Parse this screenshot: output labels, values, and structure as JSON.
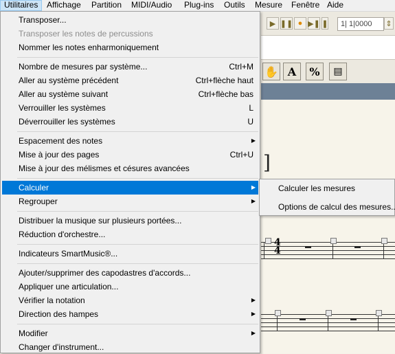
{
  "menubar": {
    "items": [
      "Utilitaires",
      "Affichage",
      "Partition",
      "MIDI/Audio",
      "Plug-ins",
      "Outils",
      "Mesure",
      "Fenêtre",
      "Aide"
    ]
  },
  "background": {
    "counter_value": "1| 1|0000",
    "tool_a": "A",
    "tool_percent": "%"
  },
  "menu": {
    "items": [
      {
        "label": "Transposer...",
        "shortcut": "",
        "submenu": false,
        "disabled": false
      },
      {
        "label": "Transposer les notes de percussions",
        "shortcut": "",
        "submenu": false,
        "disabled": true
      },
      {
        "label": "Nommer les notes enharmoniquement",
        "shortcut": "",
        "submenu": false,
        "disabled": false
      },
      {
        "label": "Nombre de mesures par système...",
        "shortcut": "Ctrl+M",
        "submenu": false,
        "disabled": false
      },
      {
        "label": "Aller au système précédent",
        "shortcut": "Ctrl+flèche haut",
        "submenu": false,
        "disabled": false
      },
      {
        "label": "Aller au système suivant",
        "shortcut": "Ctrl+flèche bas",
        "submenu": false,
        "disabled": false
      },
      {
        "label": "Verrouiller les systèmes",
        "shortcut": "L",
        "submenu": false,
        "disabled": false
      },
      {
        "label": "Déverrouiller les systèmes",
        "shortcut": "U",
        "submenu": false,
        "disabled": false
      },
      {
        "label": "Espacement des notes",
        "shortcut": "",
        "submenu": true,
        "disabled": false
      },
      {
        "label": "Mise à jour des pages",
        "shortcut": "Ctrl+U",
        "submenu": false,
        "disabled": false
      },
      {
        "label": "Mise à jour des mélismes et césures avancées",
        "shortcut": "",
        "submenu": false,
        "disabled": false
      },
      {
        "label": "Calculer",
        "shortcut": "",
        "submenu": true,
        "disabled": false
      },
      {
        "label": "Regrouper",
        "shortcut": "",
        "submenu": true,
        "disabled": false
      },
      {
        "label": "Distribuer la musique sur plusieurs portées...",
        "shortcut": "",
        "submenu": false,
        "disabled": false
      },
      {
        "label": "Réduction d'orchestre...",
        "shortcut": "",
        "submenu": false,
        "disabled": false
      },
      {
        "label": "Indicateurs SmartMusic®...",
        "shortcut": "",
        "submenu": false,
        "disabled": false
      },
      {
        "label": "Ajouter/supprimer des capodastres d'accords...",
        "shortcut": "",
        "submenu": false,
        "disabled": false
      },
      {
        "label": "Appliquer une articulation...",
        "shortcut": "",
        "submenu": false,
        "disabled": false
      },
      {
        "label": "Vérifier la notation",
        "shortcut": "",
        "submenu": true,
        "disabled": false
      },
      {
        "label": "Direction des hampes",
        "shortcut": "",
        "submenu": true,
        "disabled": false
      },
      {
        "label": "Modifier",
        "shortcut": "",
        "submenu": true,
        "disabled": false
      },
      {
        "label": "Changer d'instrument...",
        "shortcut": "",
        "submenu": false,
        "disabled": false
      }
    ]
  },
  "submenu": {
    "items": [
      "Calculer les mesures",
      "Options de calcul des mesures..."
    ]
  }
}
